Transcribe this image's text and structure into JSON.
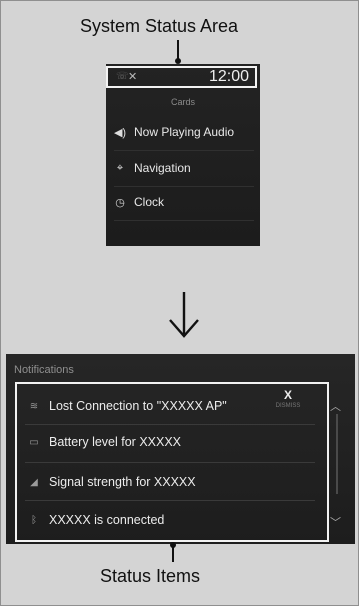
{
  "captions": {
    "top": "System Status Area",
    "bottom": "Status Items"
  },
  "top_screen": {
    "time": "12:00",
    "cards_title": "Cards",
    "cards": [
      {
        "icon": "speaker-icon",
        "label": "Now Playing Audio"
      },
      {
        "icon": "navigation-icon",
        "label": "Navigation"
      },
      {
        "icon": "clock-icon",
        "label": "Clock"
      }
    ]
  },
  "notifications": {
    "title": "Notifications",
    "items": [
      {
        "icon": "wifi-icon",
        "label": "Lost Connection to \"XXXXX AP\""
      },
      {
        "icon": "battery-icon",
        "label": "Battery level for XXXXX"
      },
      {
        "icon": "signal-icon",
        "label": "Signal strength for XXXXX"
      },
      {
        "icon": "bluetooth-icon",
        "label": "XXXXX is connected"
      }
    ],
    "dismiss_x": "X",
    "dismiss_text": "DISMISS"
  }
}
